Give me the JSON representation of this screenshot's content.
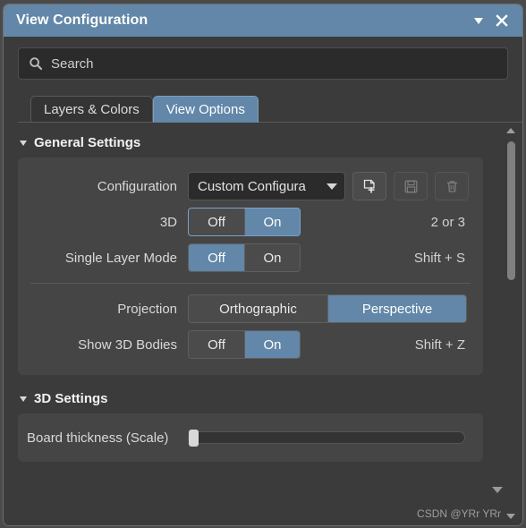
{
  "window": {
    "title": "View Configuration",
    "collapse_icon": "chevron-down-icon",
    "close_icon": "close-icon"
  },
  "search": {
    "placeholder": "Search",
    "value": "",
    "icon": "search-icon"
  },
  "tabs": [
    {
      "label": "Layers & Colors",
      "active": false
    },
    {
      "label": "View Options",
      "active": true
    }
  ],
  "sections": [
    {
      "title": "General Settings",
      "expanded": true,
      "caret_icon": "caret-expanded-icon"
    },
    {
      "title": "3D Settings",
      "expanded": true,
      "caret_icon": "caret-expanded-icon"
    }
  ],
  "general_settings": {
    "configuration": {
      "label": "Configuration",
      "value": "Custom Configura",
      "caret_icon": "chevron-down-icon",
      "buttons": [
        {
          "name": "new-configuration-button",
          "icon": "new-page-plus-icon",
          "disabled": false
        },
        {
          "name": "save-configuration-button",
          "icon": "floppy-save-icon",
          "disabled": true
        },
        {
          "name": "delete-configuration-button",
          "icon": "trash-icon",
          "disabled": true
        }
      ]
    },
    "three_d": {
      "label": "3D",
      "options": [
        "Off",
        "On"
      ],
      "selected": "On",
      "focused": true,
      "shortcut": "2 or 3"
    },
    "single_layer_mode": {
      "label": "Single Layer Mode",
      "options": [
        "Off",
        "On"
      ],
      "selected": "Off",
      "focused": false,
      "shortcut": "Shift + S"
    },
    "projection": {
      "label": "Projection",
      "options": [
        "Orthographic",
        "Perspective"
      ],
      "selected": "Perspective",
      "shortcut": ""
    },
    "show_3d_bodies": {
      "label": "Show 3D Bodies",
      "options": [
        "Off",
        "On"
      ],
      "selected": "On",
      "shortcut": "Shift + Z"
    }
  },
  "three_d_settings": {
    "board_thickness": {
      "label": "Board thickness (Scale)",
      "value_percent": 0,
      "expand_icon": "chevron-down-icon"
    }
  },
  "scrollbar": {
    "up_icon": "triangle-up-icon",
    "down_icon": "triangle-down-icon"
  },
  "watermark": "CSDN @YRr YRr",
  "colors": {
    "accent": "#6287a8",
    "panel": "#454545",
    "background": "#3b3b3b",
    "field": "#2b2b2b"
  }
}
